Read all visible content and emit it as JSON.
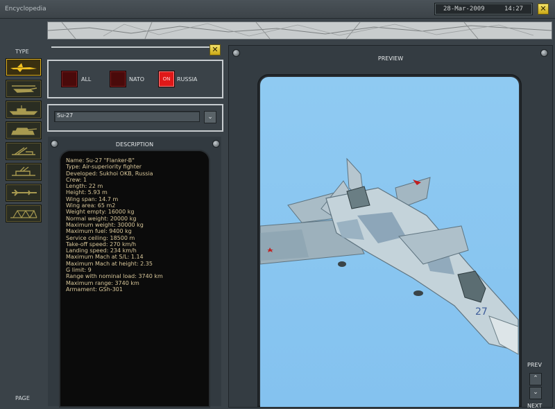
{
  "window": {
    "title": "Encyclopedia",
    "date": "28-Mar-2009",
    "time": "14:27",
    "close_icon": "close-icon"
  },
  "sidebar": {
    "type_label": "TYPE",
    "page_label": "PAGE",
    "types": [
      {
        "icon": "fighter-aircraft-icon",
        "active": true
      },
      {
        "icon": "helicopter-icon",
        "active": false
      },
      {
        "icon": "ship-icon",
        "active": false
      },
      {
        "icon": "tank-icon",
        "active": false
      },
      {
        "icon": "missile-launcher-icon",
        "active": false
      },
      {
        "icon": "air-defense-icon",
        "active": false
      },
      {
        "icon": "missile-icon",
        "active": false
      },
      {
        "icon": "structure-icon",
        "active": false
      }
    ]
  },
  "filters": {
    "all_label": "ALL",
    "nato_label": "NATO",
    "russia_label": "RUSSIA",
    "on_text": "ON",
    "all_on": false,
    "nato_on": false,
    "russia_on": true
  },
  "selector": {
    "value": "Su-27"
  },
  "description": {
    "title": "DESCRIPTION",
    "lines": [
      "Name: Su-27 \"Flanker-B\"",
      "Type: Air-superiority fighter",
      "Developed: Sukhoi OKB, Russia",
      "Crew: 1",
      "Length: 22 m",
      "Height: 5.93 m",
      "Wing span: 14.7 m",
      "Wing area: 65 m2",
      "Weight empty: 16000 kg",
      "Normal weight: 20000 kg",
      "Maximum weight: 30000 kg",
      "Maximum fuel: 9400 kg",
      "Service ceiling: 18500 m",
      "Take-off speed: 270 km/h",
      "Landing speed: 234 km/h",
      "Maximum Mach at S/L: 1.14",
      "Maximum Mach at height: 2.35",
      "G limit: 9",
      "Range with nominal load: 3740 km",
      "Maximum range: 3740 km",
      "Armament: GSh-301"
    ]
  },
  "preview": {
    "title": "PREVIEW",
    "prev_label": "PREV",
    "next_label": "NEXT",
    "tail_number": "27",
    "sky_color": "#8ccaf2"
  }
}
